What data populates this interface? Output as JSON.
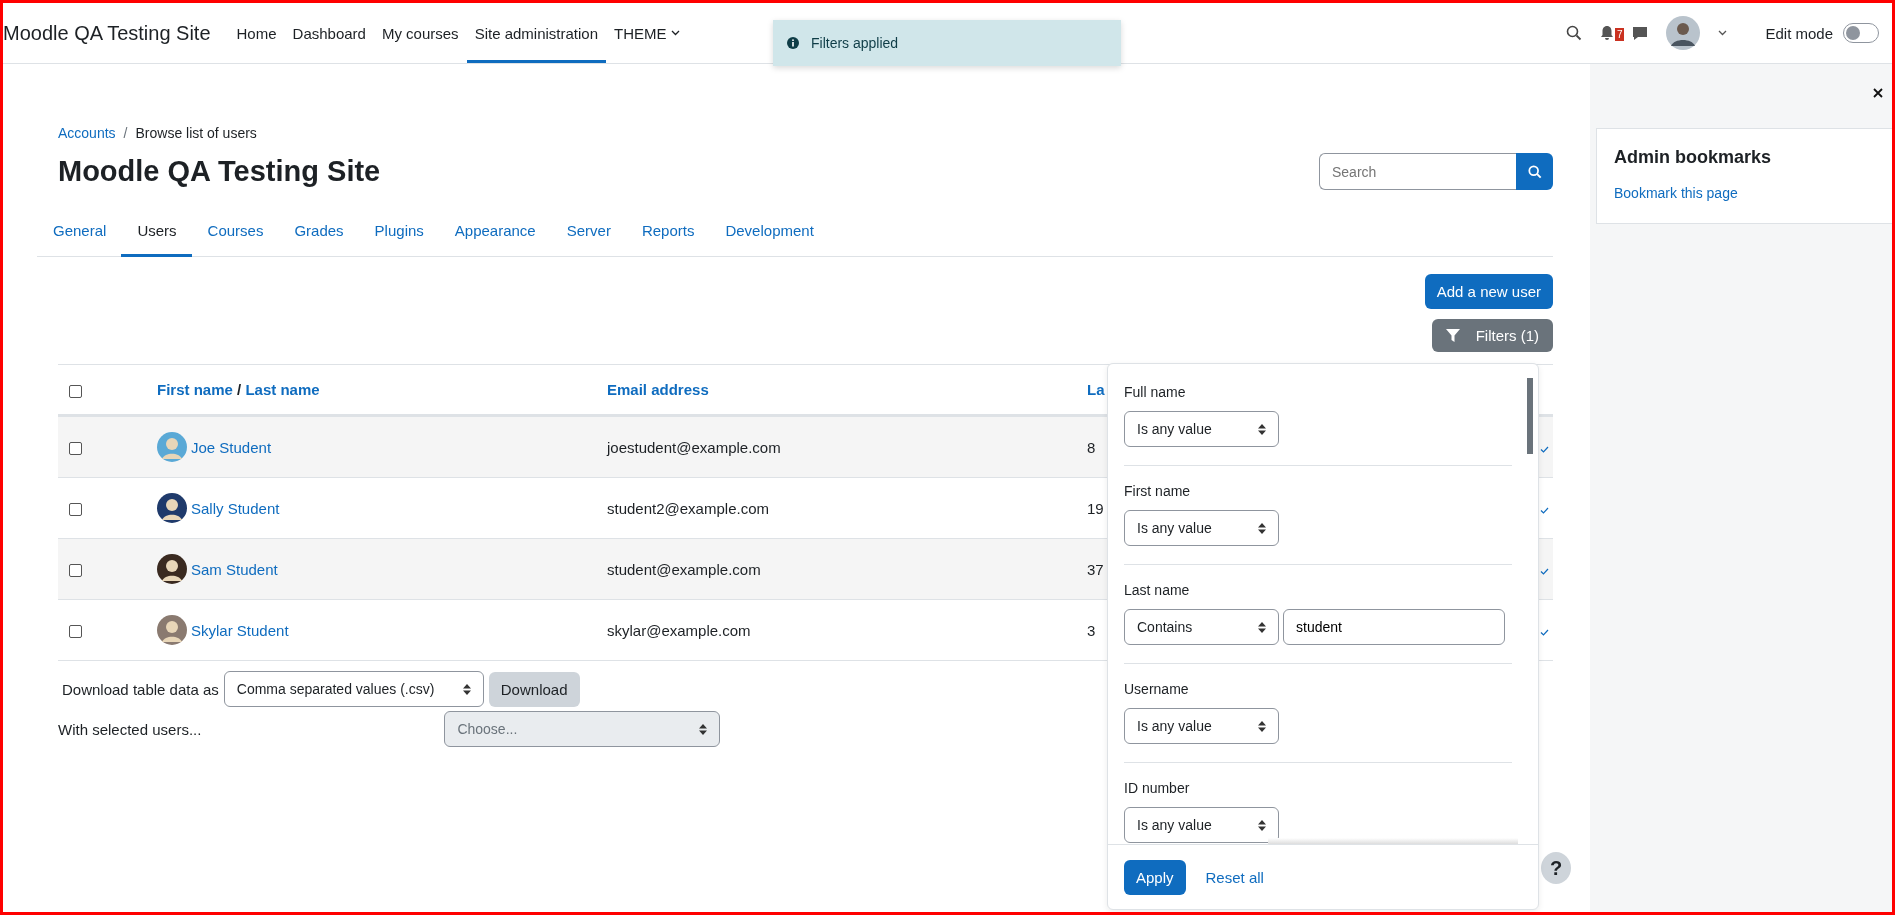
{
  "navbar": {
    "brand": "Moodle QA Testing Site",
    "items": [
      {
        "label": "Home",
        "selected": false
      },
      {
        "label": "Dashboard",
        "selected": false
      },
      {
        "label": "My courses",
        "selected": false
      },
      {
        "label": "Site administration",
        "selected": true
      }
    ],
    "theme_menu": "THEME",
    "notification_count": "7",
    "edit_mode": {
      "label": "Edit mode",
      "on": false
    }
  },
  "toast": {
    "text": "Filters applied"
  },
  "breadcrumb_separator": "/",
  "breadcrumb": [
    {
      "label": "Accounts",
      "link": true
    },
    {
      "label": "Browse list of users",
      "link": false
    }
  ],
  "heading": "Moodle QA Testing Site",
  "search": {
    "placeholder": "Search"
  },
  "tabs": [
    {
      "label": "General",
      "selected": false
    },
    {
      "label": "Users",
      "selected": true
    },
    {
      "label": "Courses",
      "selected": false
    },
    {
      "label": "Grades",
      "selected": false
    },
    {
      "label": "Plugins",
      "selected": false
    },
    {
      "label": "Appearance",
      "selected": false
    },
    {
      "label": "Server",
      "selected": false
    },
    {
      "label": "Reports",
      "selected": false
    },
    {
      "label": "Development",
      "selected": false
    }
  ],
  "actions": {
    "add_user": "Add a new user",
    "filters": "Filters (1)"
  },
  "table": {
    "header_checked": false,
    "first_name": "First name",
    "name_separator": "/",
    "last_name": "Last name",
    "email": "Email address",
    "column_3": "La",
    "rows": [
      {
        "checked": false,
        "name": "Joe Student",
        "email": "joestudent@example.com",
        "column_3": "8",
        "color": "#5aa9d6"
      },
      {
        "checked": false,
        "name": "Sally Student",
        "email": "student2@example.com",
        "column_3": "19",
        "color": "#1f3a6b"
      },
      {
        "checked": false,
        "name": "Sam Student",
        "email": "student@example.com",
        "column_3": "37",
        "color": "#3a2a20"
      },
      {
        "checked": false,
        "name": "Skylar Student",
        "email": "skylar@example.com",
        "column_3": "3",
        "color": "#8a7a70"
      }
    ]
  },
  "download": {
    "label": "Download table data as",
    "format": "Comma separated values (.csv)",
    "button": "Download"
  },
  "bulk": {
    "label": "With selected users...",
    "placeholder": "Choose...",
    "disabled": true
  },
  "filters_panel": {
    "filters": [
      {
        "label": "Full name",
        "operator": "Is any value"
      },
      {
        "label": "First name",
        "operator": "Is any value"
      },
      {
        "label": "Last name",
        "operator": "Contains",
        "value": "student"
      },
      {
        "label": "Username",
        "operator": "Is any value"
      },
      {
        "label": "ID number",
        "operator": "Is any value"
      }
    ],
    "apply": "Apply",
    "reset": "Reset all"
  },
  "drawer": {
    "title": "Admin bookmarks",
    "link": "Bookmark this page"
  },
  "help": "?"
}
